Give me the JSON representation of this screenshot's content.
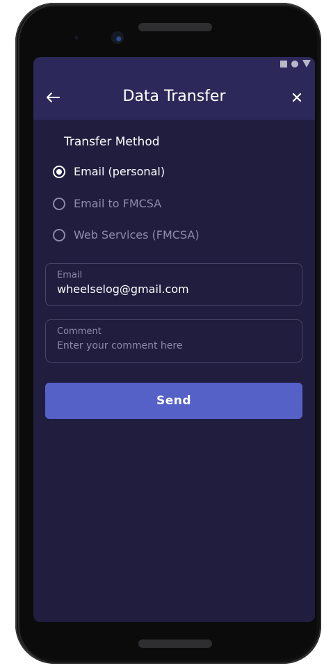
{
  "header": {
    "title": "Data Transfer",
    "back_icon": "arrow-left-icon",
    "close_icon": "close-icon"
  },
  "transfer_method": {
    "heading": "Transfer Method",
    "options": [
      {
        "label": "Email (personal)",
        "selected": true,
        "enabled": true
      },
      {
        "label": "Email to FMCSA",
        "selected": false,
        "enabled": false
      },
      {
        "label": "Web Services (FMCSA)",
        "selected": false,
        "enabled": false
      }
    ]
  },
  "email_field": {
    "label": "Email",
    "value": "wheelselog@gmail.com"
  },
  "comment_field": {
    "label": "Comment",
    "placeholder": "Enter your comment here"
  },
  "send_button": {
    "label": "Send"
  },
  "colors": {
    "screen_bg": "#201d3f",
    "appbar_bg": "#2c295a",
    "accent": "#5561c6"
  }
}
